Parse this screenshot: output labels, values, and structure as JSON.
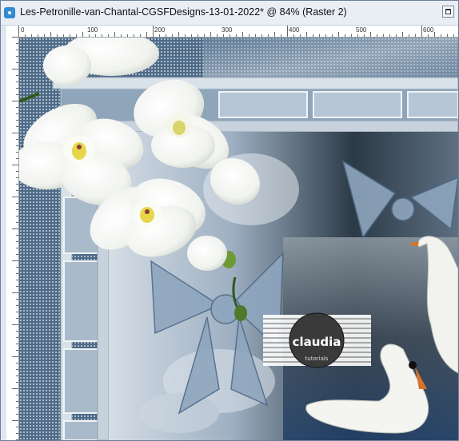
{
  "window": {
    "title": "Les-Petronille-van-Chantal-CGSFDesigns-13-01-2022* @  84% (Raster 2)"
  },
  "ruler": {
    "top_labels": [
      "0",
      "100",
      "200",
      "300",
      "400",
      "500",
      "600"
    ]
  },
  "canvas": {
    "watermark_text": "claudia",
    "watermark_subtext": "tutorials"
  },
  "colors": {
    "accent": "#2e8ad1",
    "background_blue": "#5e7890",
    "frame_silver": "#c7d2dd"
  }
}
